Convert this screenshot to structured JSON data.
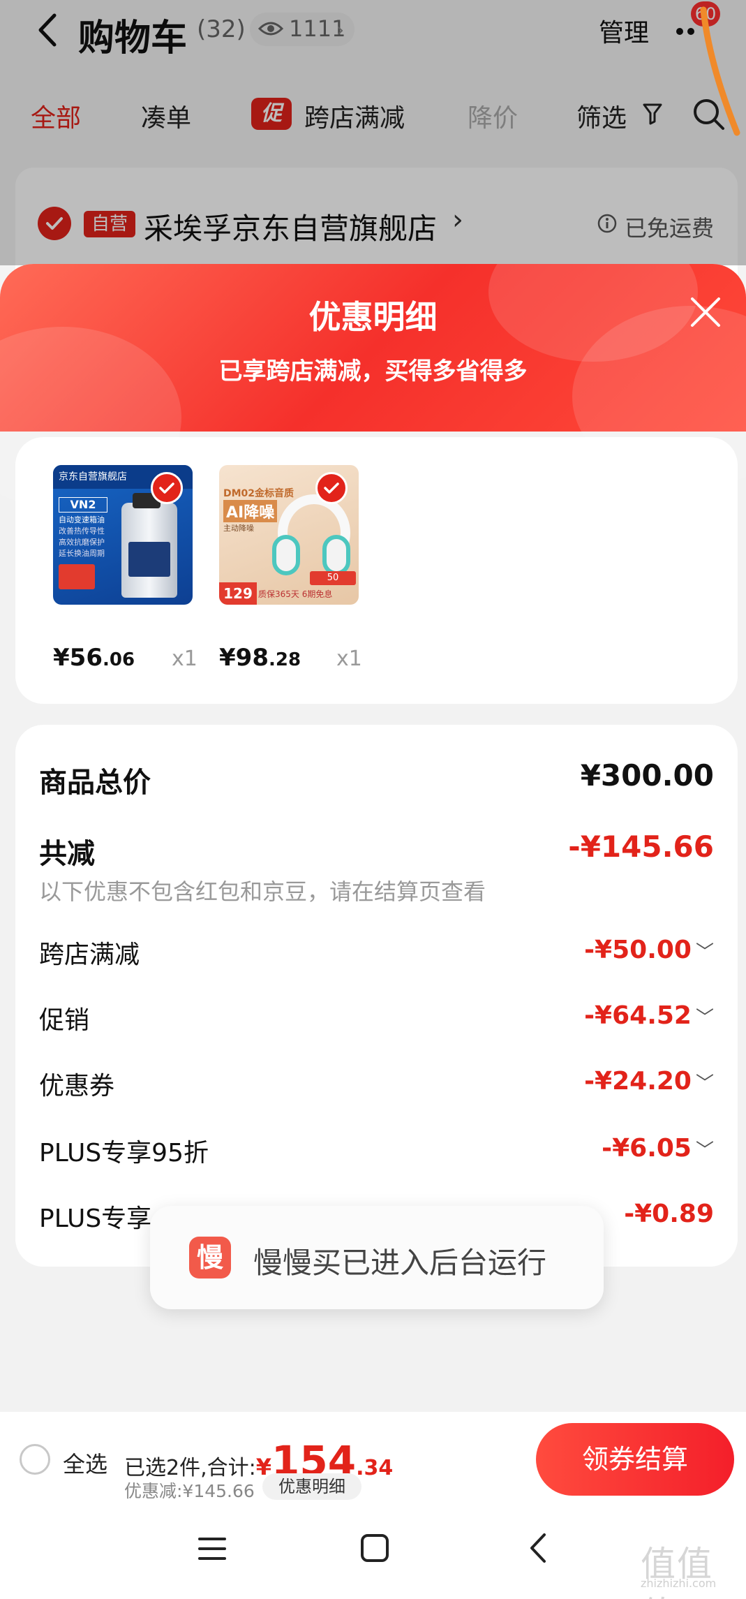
{
  "header": {
    "title": "购物车",
    "count": "(32)",
    "views": "1111",
    "manage": "管理",
    "badge": "60"
  },
  "tabs": [
    {
      "label": "全部"
    },
    {
      "label": "凑单"
    },
    {
      "label": "跨店满减",
      "icon_text": "促"
    },
    {
      "label": "降价"
    },
    {
      "label": "筛选"
    }
  ],
  "store": {
    "tag": "自营",
    "name": "采埃孚京东自营旗舰店",
    "shipping": "已免运费"
  },
  "sheet": {
    "title": "优惠明细",
    "subtitle": "已享跨店满减，买得多省得多"
  },
  "products": [
    {
      "price_int": "¥56",
      "price_dec": ".06",
      "qty": "x1",
      "image": {
        "brand": "京东自营旗舰店",
        "model": "VN2",
        "lines": [
          "自动变速箱油",
          "改善热传导性",
          "高效抗磨保护",
          "延长换油周期"
        ]
      }
    },
    {
      "price_int": "¥98",
      "price_dec": ".28",
      "qty": "x1",
      "image": {
        "headline": "DM02金标音质",
        "sub": "AI降噪",
        "lines": [
          "主动降噪"
        ],
        "price": "129",
        "footer": "质保365天 6期免息",
        "badge": "50"
      }
    }
  ],
  "summary": {
    "total_label": "商品总价",
    "total_value": "¥300.00",
    "reduce_label": "共减",
    "reduce_value": "-¥145.66",
    "note": "以下优惠不包含红包和京豆，请在结算页查看",
    "items": [
      {
        "label": "跨店满减",
        "value": "-¥50.00"
      },
      {
        "label": "促销",
        "value": "-¥64.52"
      },
      {
        "label": "优惠券",
        "value": "-¥24.20"
      },
      {
        "label": "PLUS专享95折",
        "value": "-¥6.05"
      },
      {
        "label": "PLUS专享",
        "value": "-¥0.89"
      }
    ]
  },
  "toast": {
    "icon_text": "慢",
    "text": "慢慢买已进入后台运行"
  },
  "bottom": {
    "select_all": "全选",
    "selected": "已选2件,合计:",
    "currency": "¥",
    "total_int": "154",
    "total_dec": ".34",
    "discount": "优惠减:¥145.66",
    "detail": "优惠明细",
    "checkout": "领券结算"
  },
  "watermark": {
    "text": "值值值",
    "url": "zhizhizhi.com"
  },
  "colors": {
    "brand_red": "#e2231a",
    "sheet_gradient": [
      "#ff6b57",
      "#f5302b"
    ]
  }
}
